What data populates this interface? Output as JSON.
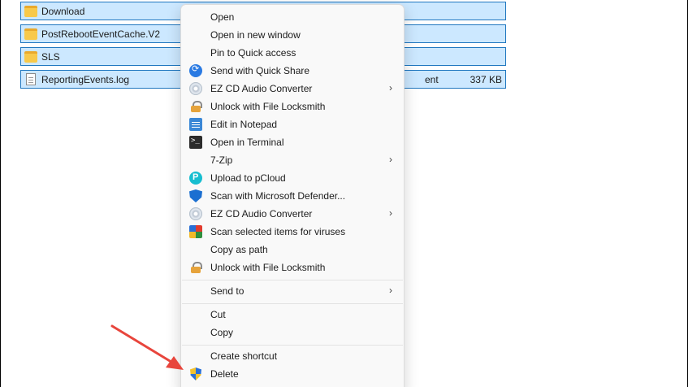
{
  "files": [
    {
      "name": "Download",
      "type": "",
      "size": "",
      "icon": "folder-icon"
    },
    {
      "name": "PostRebootEventCache.V2",
      "type": "",
      "size": "",
      "icon": "folder-icon"
    },
    {
      "name": "SLS",
      "type": "",
      "size": "",
      "icon": "folder-icon"
    },
    {
      "name": "ReportingEvents.log",
      "type": "ent",
      "size": "337 KB",
      "icon": "text-file-icon"
    }
  ],
  "context_menu": {
    "items": [
      {
        "label": "Open",
        "icon": ""
      },
      {
        "label": "Open in new window",
        "icon": ""
      },
      {
        "label": "Pin to Quick access",
        "icon": ""
      },
      {
        "label": "Send with Quick Share",
        "icon": "quick-share-icon"
      },
      {
        "label": "EZ CD Audio Converter",
        "icon": "cd-icon",
        "submenu": true
      },
      {
        "label": "Unlock with File Locksmith",
        "icon": "lock-icon"
      },
      {
        "label": "Edit in Notepad",
        "icon": "notepad-icon"
      },
      {
        "label": "Open in Terminal",
        "icon": "terminal-icon"
      },
      {
        "label": "7-Zip",
        "icon": "",
        "submenu": true
      },
      {
        "label": "Upload to pCloud",
        "icon": "pcloud-icon"
      },
      {
        "label": "Scan with Microsoft Defender...",
        "icon": "defender-shield-icon"
      },
      {
        "label": "EZ CD Audio Converter",
        "icon": "cd-icon",
        "submenu": true
      },
      {
        "label": "Scan selected items for viruses",
        "icon": "antivirus-icon"
      },
      {
        "label": "Copy as path",
        "icon": ""
      },
      {
        "label": "Unlock with File Locksmith",
        "icon": "lock-icon"
      },
      {
        "label": "Send to",
        "icon": "",
        "submenu": true
      },
      {
        "label": "Cut",
        "icon": ""
      },
      {
        "label": "Copy",
        "icon": ""
      },
      {
        "label": "Create shortcut",
        "icon": ""
      },
      {
        "label": "Delete",
        "icon": "uac-shield-icon"
      }
    ],
    "submenu_arrow": "›"
  },
  "annotation": {
    "arrow_color": "#e8453c"
  },
  "colors": {
    "selection": "#cce8ff",
    "selection_border": "#1f77c0",
    "menu_bg": "#f9f9f9"
  }
}
